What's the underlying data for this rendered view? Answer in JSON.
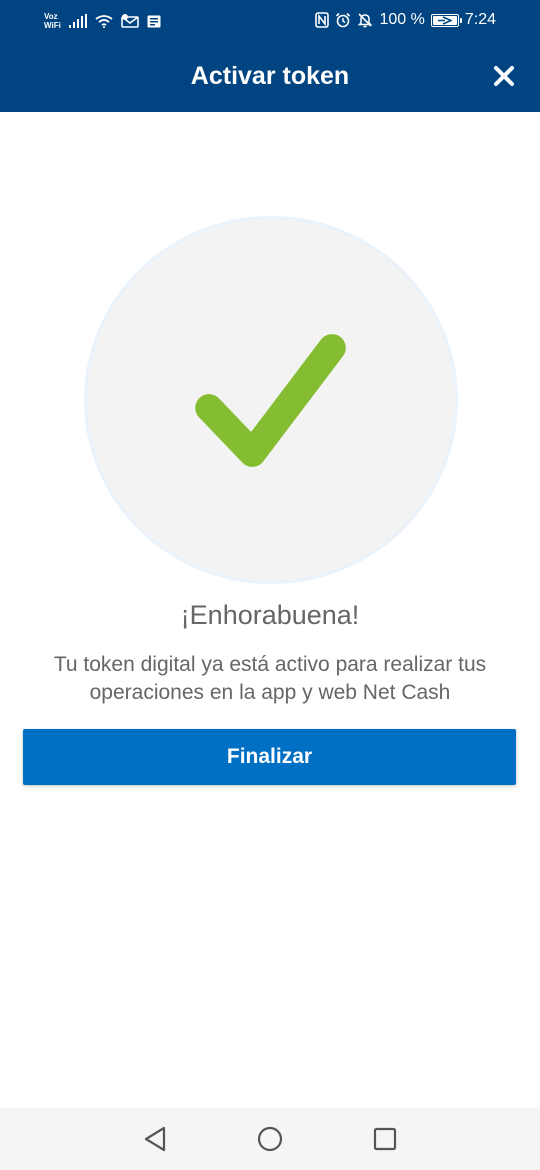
{
  "status_bar": {
    "carrier_line1": "Voz",
    "carrier_line2": "WiFi",
    "battery_text": "100 %",
    "battery_level": 1.0,
    "time": "7:24",
    "icons": [
      "signal-icon",
      "wifi-icon",
      "notification-icon",
      "messages-icon",
      "nfc-icon",
      "alarm-icon",
      "silent-icon",
      "battery-icon"
    ]
  },
  "header": {
    "title": "Activar token",
    "close_icon": "close-icon",
    "background": "#004481"
  },
  "main": {
    "icon": "checkmark-icon",
    "check_color": "#84bd32",
    "circle_color": "#f3f3f3",
    "headline": "¡Enhorabuena!",
    "message": "Tu token digital ya está activo para realizar tus operaciones en la app y web Net Cash",
    "button_label": "Finalizar",
    "button_color": "#0070c4"
  },
  "nav_bar": {
    "buttons": [
      "back-icon",
      "home-icon",
      "recents-icon"
    ]
  }
}
